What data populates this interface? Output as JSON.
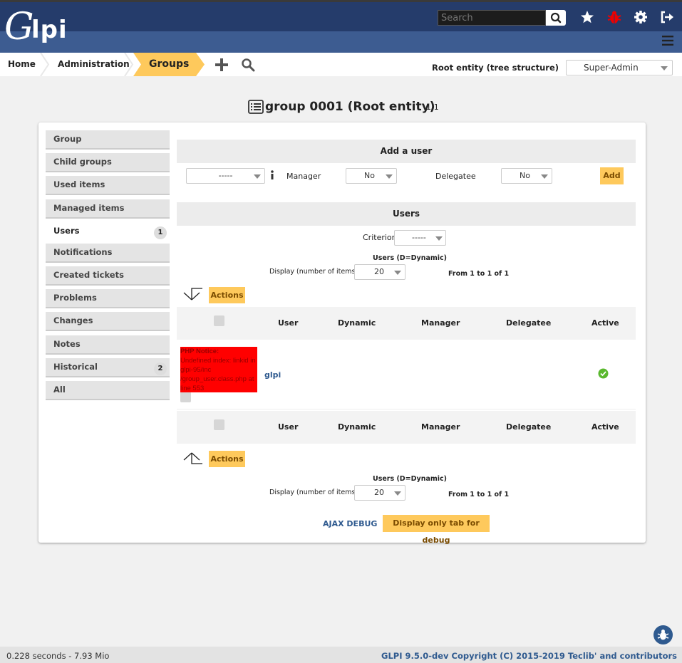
{
  "header": {
    "logo_text_g": "G",
    "logo_text_rest": "lpi",
    "search_placeholder": "Search",
    "icons": [
      "search-icon",
      "star-icon",
      "bug-icon",
      "gear-icon",
      "logout-icon",
      "menu-icon"
    ]
  },
  "breadcrumb": {
    "home": "Home",
    "admin": "Administration",
    "current": "Groups",
    "entity": "Root entity (tree structure)",
    "profile": "Super-Admin"
  },
  "title": {
    "text": "group 0001 (Root entity)",
    "counter": "1/1"
  },
  "tabs": [
    {
      "label": "Group",
      "badge": ""
    },
    {
      "label": "Child groups",
      "badge": ""
    },
    {
      "label": "Used items",
      "badge": ""
    },
    {
      "label": "Managed items",
      "badge": ""
    },
    {
      "label": "Users",
      "badge": "1"
    },
    {
      "label": "Notifications",
      "badge": ""
    },
    {
      "label": "Created tickets",
      "badge": ""
    },
    {
      "label": "Problems",
      "badge": ""
    },
    {
      "label": "Changes",
      "badge": ""
    },
    {
      "label": "Notes",
      "badge": ""
    },
    {
      "label": "Historical",
      "badge": "2"
    },
    {
      "label": "All",
      "badge": ""
    }
  ],
  "add_user": {
    "heading": "Add a user",
    "user_select": "-----",
    "manager_label": "Manager",
    "manager_value": "No",
    "delegatee_label": "Delegatee",
    "delegatee_value": "No",
    "add_button": "Add"
  },
  "users": {
    "heading": "Users",
    "criterion_label": "Criterion",
    "criterion_value": "-----",
    "dynamic_note": "Users (D=Dynamic)",
    "display_label": "Display (number of items)",
    "display_value": "20",
    "range_text": "From 1 to 1 of 1",
    "actions_button": "Actions",
    "columns": [
      "User",
      "Dynamic",
      "Manager",
      "Delegatee",
      "Active"
    ],
    "rows": [
      {
        "user": "glpi",
        "active": true
      }
    ],
    "php_notice_title": "PHP Notice:",
    "php_notice_body": "Undefined index: linkid in glpi-95/inc /group_user.class.php at line 553"
  },
  "debug": {
    "ajax_debug": "AJAX DEBUG",
    "display_only_tab": "Display only tab for debug"
  },
  "footer": {
    "time": "0.228 seconds - 7.93 Mio",
    "copyright": "GLPI 9.5.0-dev Copyright (C) 2015-2019 Teclib' and contributors"
  },
  "colors": {
    "header_dark": "#253c6b",
    "header_light": "#3d5c91",
    "accent": "#fec95c",
    "link": "#2f5a8f"
  }
}
